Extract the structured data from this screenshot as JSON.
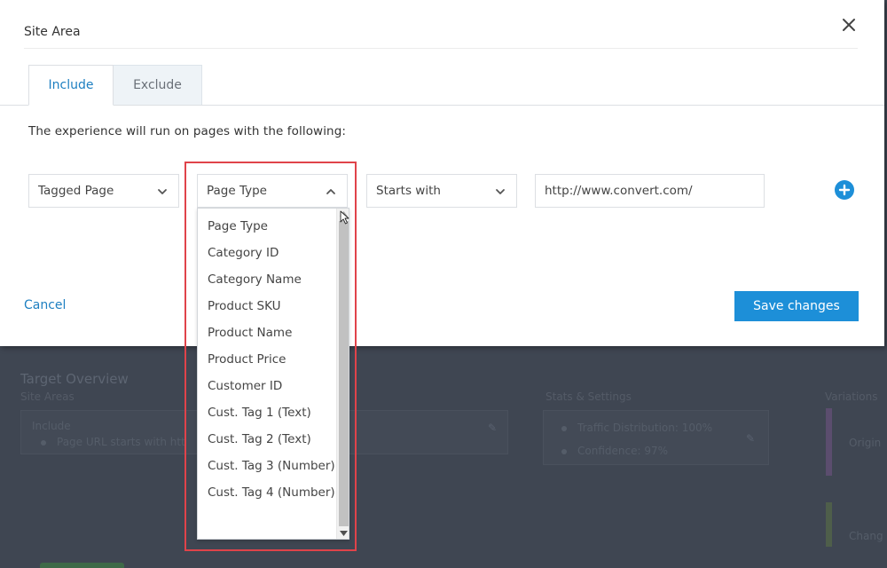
{
  "modal": {
    "title": "Site Area",
    "tabs": [
      {
        "label": "Include",
        "active": true
      },
      {
        "label": "Exclude",
        "active": false
      }
    ],
    "description": "The experience will run on pages with the following:",
    "rule": {
      "field_selected": "Tagged Page",
      "attribute_selected": "Page Type",
      "operator_selected": "Starts with",
      "value": "http://www.convert.com/"
    },
    "dropdown_options": [
      "Page Type",
      "Category ID",
      "Category Name",
      "Product SKU",
      "Product Name",
      "Product Price",
      "Customer ID",
      "Cust. Tag 1 (Text)",
      "Cust. Tag 2 (Text)",
      "Cust. Tag 3 (Number)",
      "Cust. Tag 4 (Number)"
    ],
    "cancel_label": "Cancel",
    "save_label": "Save changes"
  },
  "background": {
    "section_title": "Target Overview",
    "site_areas_label": "Site Areas",
    "include_label": "Include",
    "include_rule": "Page URL starts with htt",
    "stats_label": "Stats & Settings",
    "traffic_distribution": "Traffic Distribution: 100%",
    "confidence": "Confidence: 97%",
    "variations_label": "Variations",
    "original_label": "Origin",
    "changes_label": "Chang"
  },
  "colors": {
    "accent": "#1d8fd8",
    "highlight": "#e0434a",
    "overlay": "#3f4652"
  },
  "icons": {
    "close": "close-icon",
    "chevron_down": "chevron-down-icon",
    "chevron_up": "chevron-up-icon",
    "add": "plus-circle-icon",
    "edit": "pencil-icon"
  }
}
